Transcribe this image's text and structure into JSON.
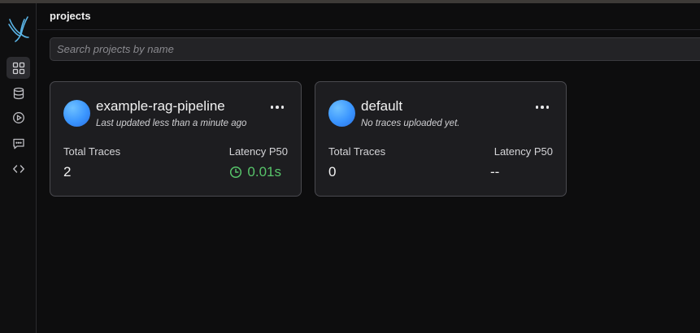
{
  "header": {
    "title": "projects"
  },
  "search": {
    "placeholder": "Search projects by name"
  },
  "sidebar": {
    "items": [
      {
        "name": "projects",
        "icon": "grid-icon",
        "active": true
      },
      {
        "name": "datasets",
        "icon": "database-icon",
        "active": false
      },
      {
        "name": "playground",
        "icon": "play-circle-icon",
        "active": false
      },
      {
        "name": "prompts",
        "icon": "message-square-icon",
        "active": false
      },
      {
        "name": "apis",
        "icon": "code-icon",
        "active": false
      }
    ]
  },
  "projects": [
    {
      "name": "example-rag-pipeline",
      "subtitle": "Last updated less than a minute ago",
      "traces_label": "Total Traces",
      "traces_value": "2",
      "latency_label": "Latency P50",
      "latency_value": "0.01s"
    },
    {
      "name": "default",
      "subtitle": "No traces uploaded yet.",
      "traces_label": "Total Traces",
      "traces_value": "0",
      "latency_label": "Latency P50",
      "latency_value": "--"
    }
  ],
  "colors": {
    "accent_logo": "#5ab4e6",
    "latency_good": "#57c46a",
    "avatar": "#3a95ff"
  }
}
